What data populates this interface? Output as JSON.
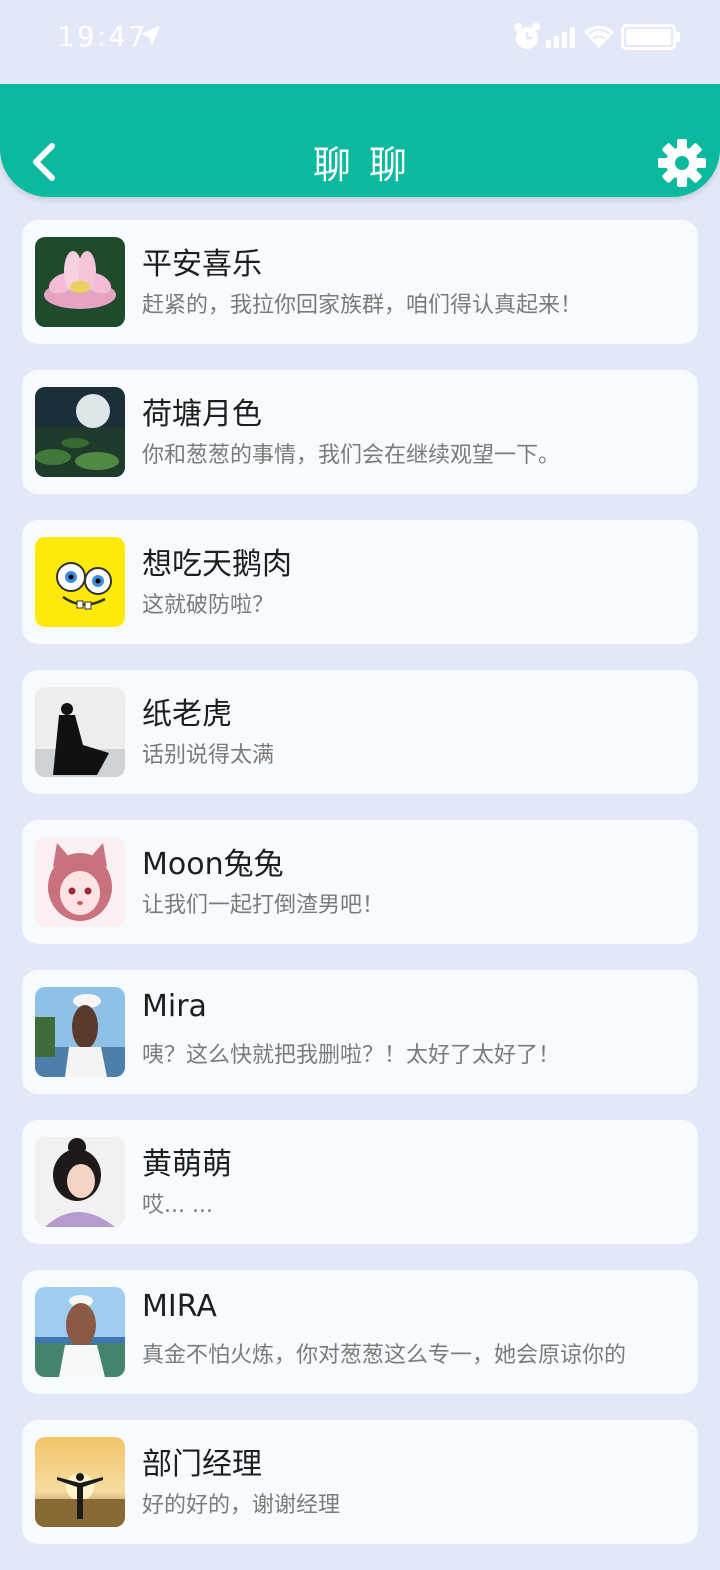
{
  "status_bar": {
    "time": "19:47"
  },
  "header": {
    "title": "聊聊"
  },
  "chats": [
    {
      "name": "平安喜乐",
      "message": "赶紧的，我拉你回家族群，咱们得认真起来！",
      "avatar": "lotus-flower"
    },
    {
      "name": "荷塘月色",
      "message": "你和葱葱的事情，我们会在继续观望一下。",
      "avatar": "moon-over-lotus-pond"
    },
    {
      "name": "想吃天鹅肉",
      "message": "这就破防啦？",
      "avatar": "cartoon-sponge"
    },
    {
      "name": "纸老虎",
      "message": "话别说得太满",
      "avatar": "person-in-cloak"
    },
    {
      "name": "Moon兔兔",
      "message": "让我们一起打倒渣男吧！",
      "avatar": "anime-cat-girl"
    },
    {
      "name": "Mira",
      "message": "咦？这么快就把我删啦？！太好了太好了！",
      "avatar": "girl-white-hat"
    },
    {
      "name": "黄萌萌",
      "message": "哎... ...",
      "avatar": "girl-dark-hair"
    },
    {
      "name": "MIRA",
      "message": "真金不怕火炼，你对葱葱这么专一，她会原谅你的",
      "avatar": "girl-lakeside"
    },
    {
      "name": "部门经理",
      "message": "好的好的，谢谢经理",
      "avatar": "man-at-sunset"
    }
  ]
}
